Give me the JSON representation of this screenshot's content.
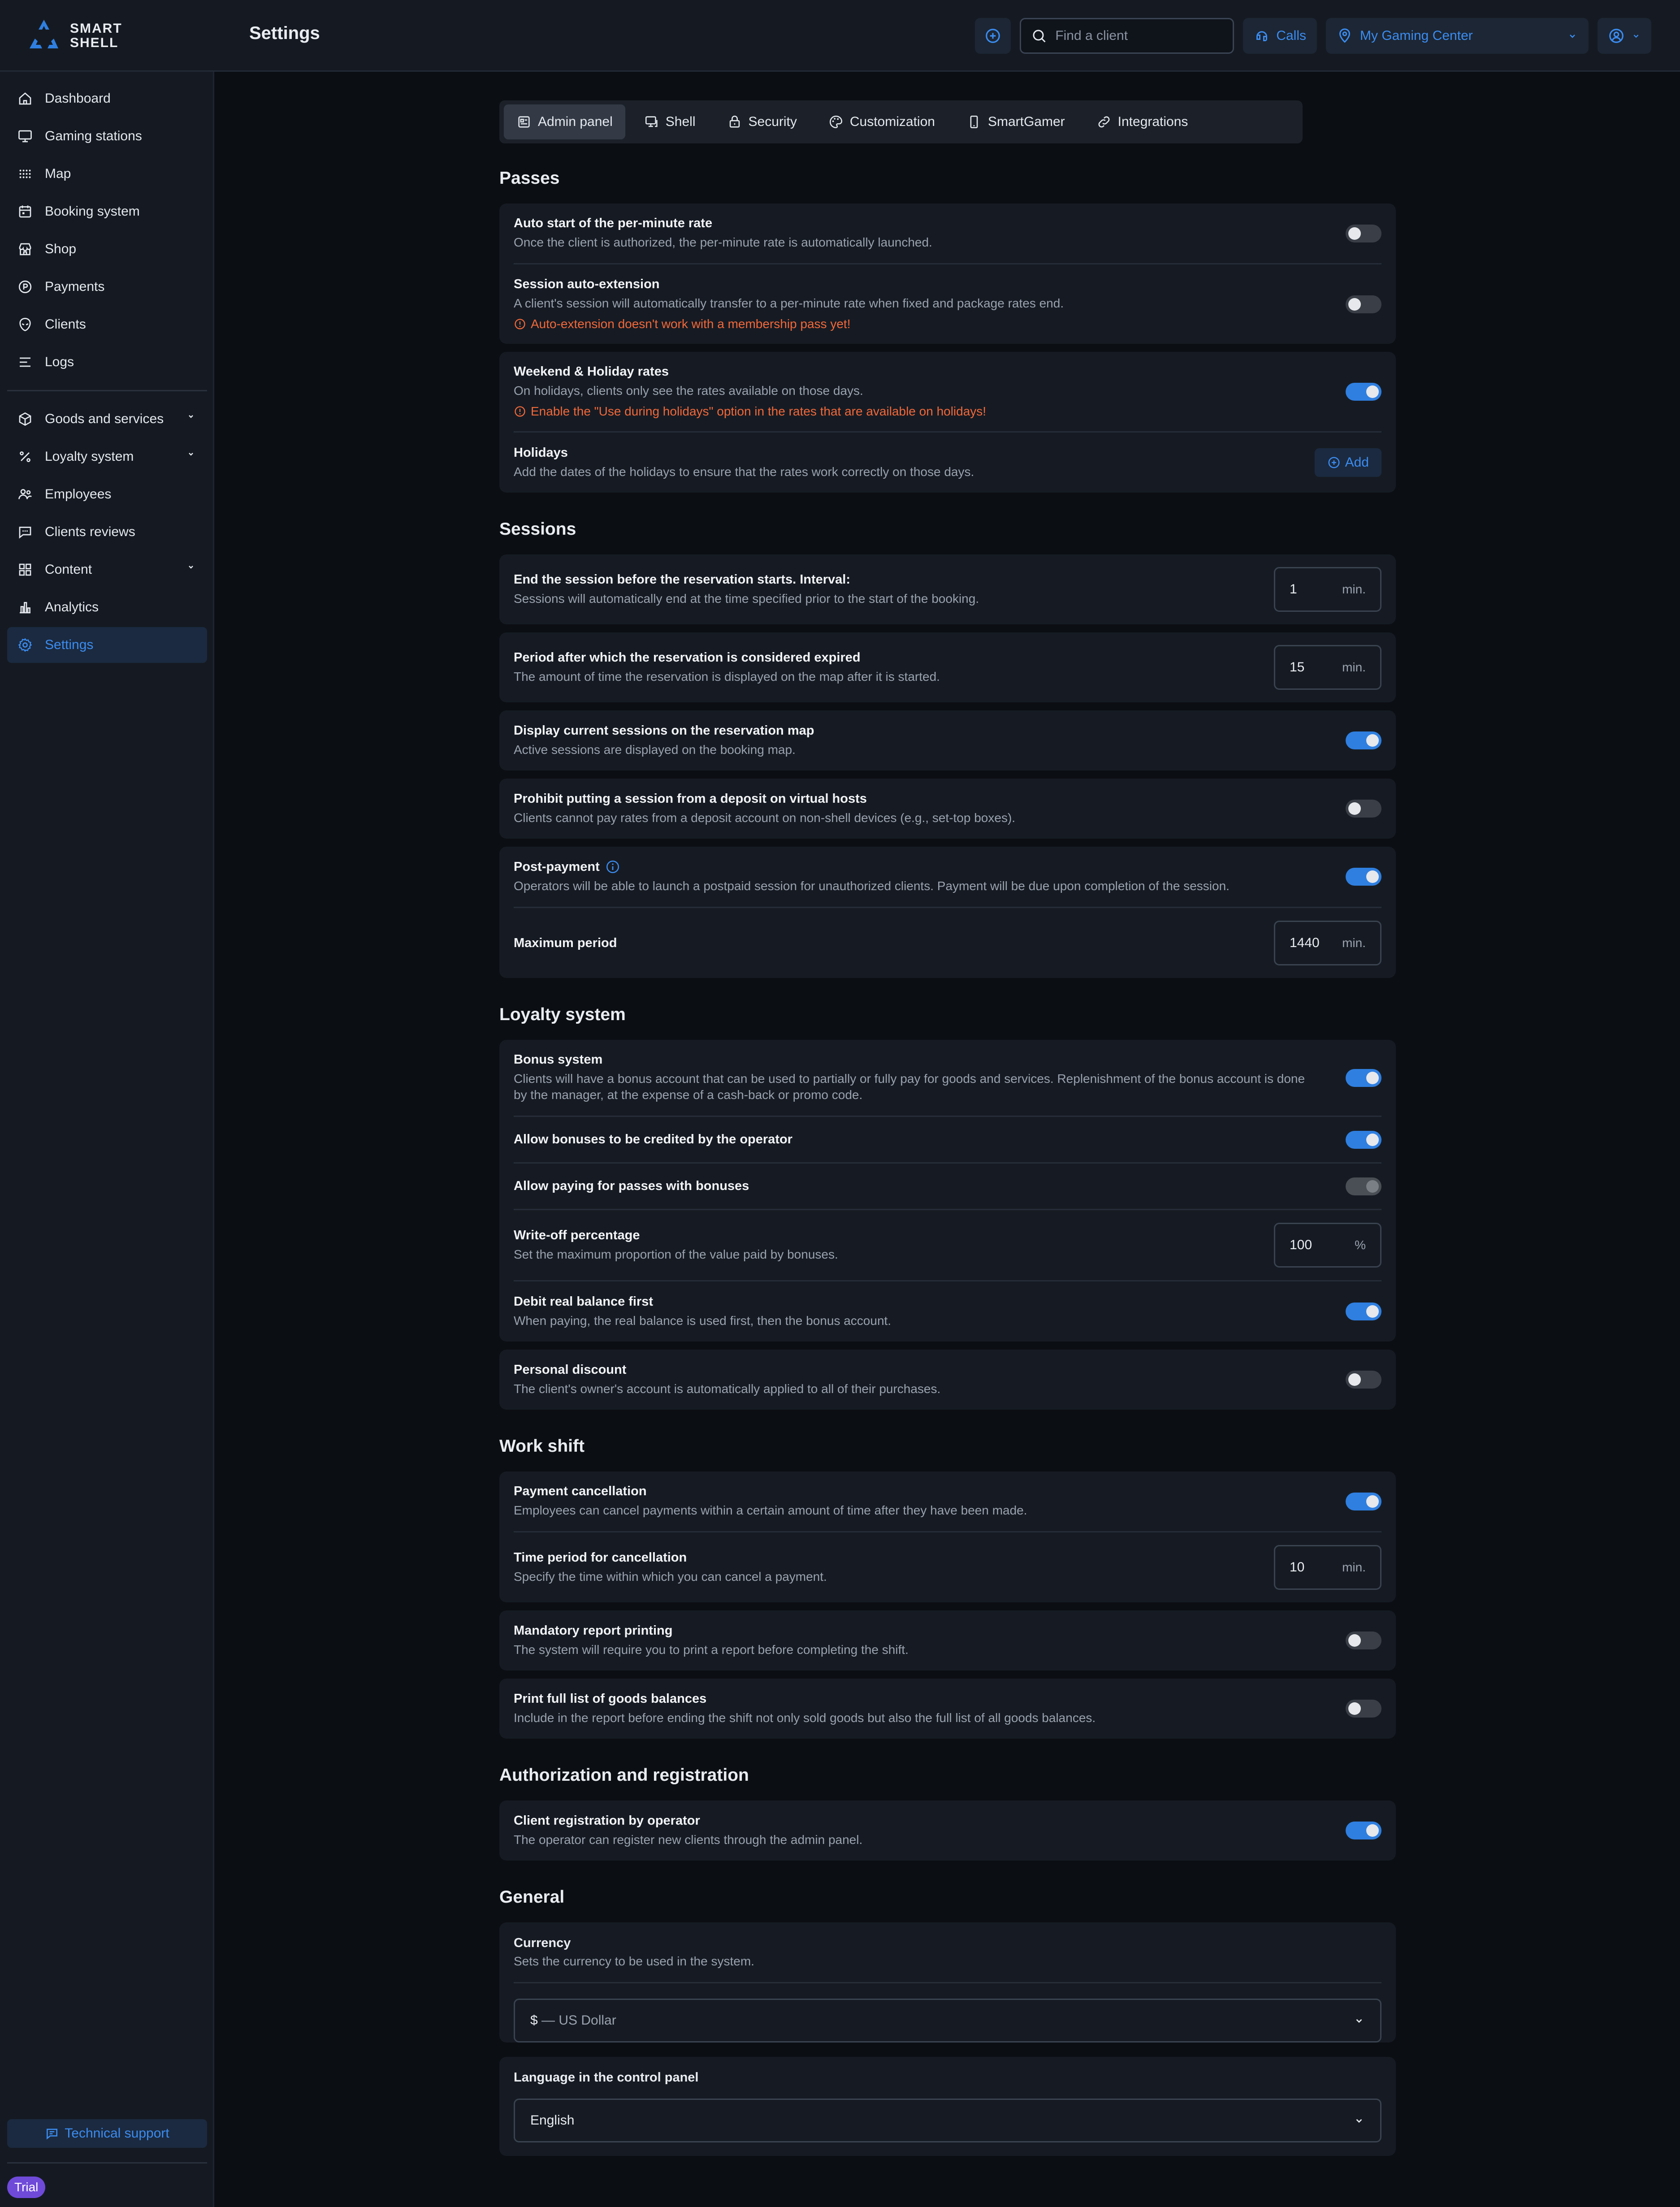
{
  "app": {
    "logo_line1": "SMART",
    "logo_line2": "SHELL",
    "page_title": "Settings"
  },
  "topbar": {
    "search_placeholder": "Find a client",
    "calls_label": "Calls",
    "location_label": "My Gaming Center"
  },
  "sidebar": {
    "items": [
      {
        "label": "Dashboard",
        "icon": "home-icon"
      },
      {
        "label": "Gaming stations",
        "icon": "monitor-icon"
      },
      {
        "label": "Map",
        "icon": "grid-dots-icon"
      },
      {
        "label": "Booking system",
        "icon": "calendar-icon"
      },
      {
        "label": "Shop",
        "icon": "store-icon"
      },
      {
        "label": "Payments",
        "icon": "coin-icon"
      },
      {
        "label": "Clients",
        "icon": "alien-icon"
      },
      {
        "label": "Logs",
        "icon": "list-icon"
      }
    ],
    "items2": [
      {
        "label": "Goods and services",
        "icon": "box-icon"
      },
      {
        "label": "Loyalty system",
        "icon": "percent-icon"
      },
      {
        "label": "Employees",
        "icon": "users-icon"
      },
      {
        "label": "Clients reviews",
        "icon": "chat-icon"
      },
      {
        "label": "Content",
        "icon": "apps-icon"
      },
      {
        "label": "Analytics",
        "icon": "chart-icon"
      },
      {
        "label": "Settings",
        "icon": "gear-icon"
      }
    ],
    "support_label": "Technical support",
    "trial_label": "Trial"
  },
  "tabs": [
    "Admin panel",
    "Shell",
    "Security",
    "Customization",
    "SmartGamer",
    "Integrations"
  ],
  "passes": {
    "title": "Passes",
    "auto_start_title": "Auto start of the per-minute rate",
    "auto_start_desc": "Once the client is authorized, the per-minute rate is automatically launched.",
    "auto_ext_title": "Session auto-extension",
    "auto_ext_desc": "A client's session will automatically transfer to a per-minute rate when fixed and package rates end.",
    "auto_ext_warn": "Auto-extension doesn't work with a membership pass yet!",
    "weekend_title": "Weekend & Holiday rates",
    "weekend_desc": "On holidays, clients only see the rates available on those days.",
    "weekend_warn": "Enable the \"Use during holidays\" option in the rates that are available on holidays!",
    "holidays_title": "Holidays",
    "holidays_desc": "Add the dates of the holidays to ensure that the rates work correctly on those days.",
    "add_label": "Add"
  },
  "sessions": {
    "title": "Sessions",
    "end_title": "End the session before the reservation starts. Interval:",
    "end_desc": "Sessions will automatically end at the time specified prior to the start of the booking.",
    "end_value": "1",
    "expired_title": "Period after which the reservation is considered expired",
    "expired_desc": "The amount of time the reservation is displayed on the map after it is started.",
    "expired_value": "15",
    "display_title": "Display current sessions on the reservation map",
    "display_desc": "Active sessions are displayed on the booking map.",
    "prohibit_title": "Prohibit putting a session from a deposit on virtual hosts",
    "prohibit_desc": "Clients cannot pay rates from a deposit account on non-shell devices (e.g., set-top boxes).",
    "post_title": "Post-payment",
    "post_desc": "Operators will be able to launch a postpaid session for unauthorized clients. Payment will be due upon completion of the session.",
    "max_title": "Maximum period",
    "max_value": "1440",
    "unit_min": "min."
  },
  "loyalty": {
    "title": "Loyalty system",
    "bonus_title": "Bonus system",
    "bonus_desc": "Clients will have a bonus account that can be used to partially or fully pay for goods and services. Replenishment of the bonus account is done by the manager, at the expense of a cash-back or promo code.",
    "allow_credit_title": "Allow bonuses to be credited by the operator",
    "allow_pass_title": "Allow paying for passes with bonuses",
    "writeoff_title": "Write-off percentage",
    "writeoff_desc": "Set the maximum proportion of the value paid by bonuses.",
    "writeoff_value": "100",
    "writeoff_unit": "%",
    "debit_title": "Debit real balance first",
    "debit_desc": "When paying, the real balance is used first, then the bonus account.",
    "discount_title": "Personal discount",
    "discount_desc": "The client's owner's account is automatically applied to all of their purchases."
  },
  "workshift": {
    "title": "Work shift",
    "cancel_title": "Payment cancellation",
    "cancel_desc": "Employees can cancel payments within a certain amount of time after they have been made.",
    "period_title": "Time period for cancellation",
    "period_desc": "Specify the time within which you can cancel a payment.",
    "period_value": "10",
    "report_title": "Mandatory report printing",
    "report_desc": "The system will require you to print a report before completing the shift.",
    "print_title": "Print full list of goods balances",
    "print_desc": "Include in the report before ending the shift not only sold goods but also the full list of all goods balances."
  },
  "auth": {
    "title": "Authorization and registration",
    "reg_title": "Client registration by operator",
    "reg_desc": "The operator can register new clients through the admin panel."
  },
  "general": {
    "title": "General",
    "currency_title": "Currency",
    "currency_desc": "Sets the currency to be used in the system.",
    "currency_symbol": "$",
    "currency_value": " — US Dollar",
    "language_title": "Language in the control panel",
    "language_value": "English"
  },
  "colors": {
    "accent": "#3b8cf0",
    "warning": "#f2683a",
    "trial": "#6f4ad9"
  }
}
